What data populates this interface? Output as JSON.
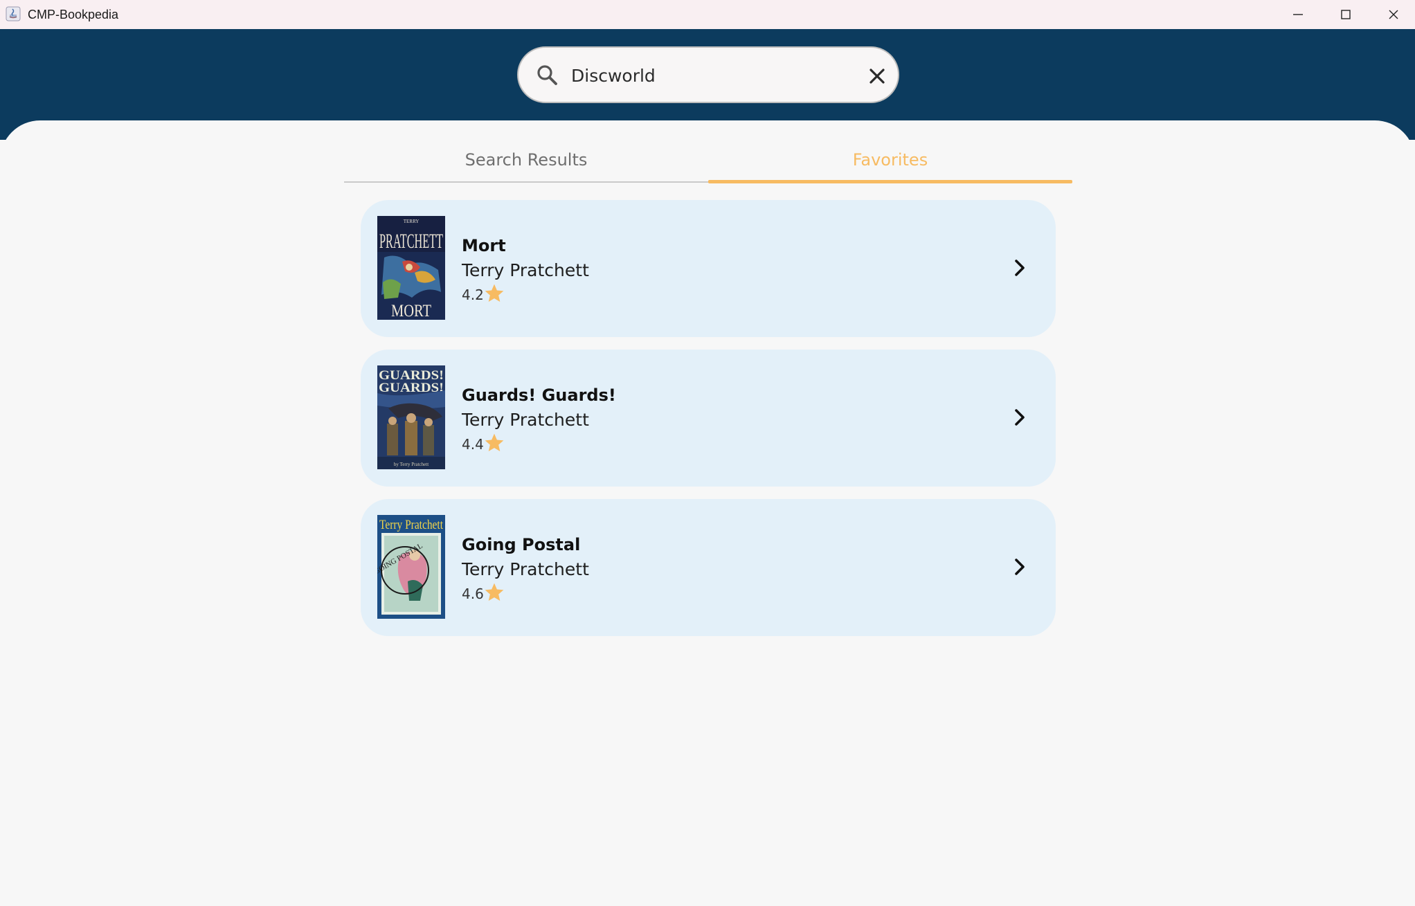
{
  "window": {
    "title": "CMP-Bookpedia",
    "controls": [
      "minimize-icon",
      "maximize-icon",
      "close-icon"
    ]
  },
  "search": {
    "value": "Discworld",
    "placeholder": "",
    "icon": "search-icon",
    "clear_icon": "close-icon"
  },
  "tabs": [
    {
      "label": "Search Results",
      "selected": false
    },
    {
      "label": "Favorites",
      "selected": true
    }
  ],
  "books": [
    {
      "title": "Mort",
      "author": "Terry Pratchett",
      "rating": "4.2",
      "cover_icon": "mort-book-cover"
    },
    {
      "title": "Guards! Guards!",
      "author": "Terry Pratchett",
      "rating": "4.4",
      "cover_icon": "guards-guards-book-cover"
    },
    {
      "title": "Going Postal",
      "author": "Terry Pratchett",
      "rating": "4.6",
      "cover_icon": "going-postal-book-cover"
    }
  ],
  "colors": {
    "header": "#0c3b5e",
    "accent": "#f7bb62",
    "card": "#e3f0f9",
    "background": "#f7f7f7"
  }
}
